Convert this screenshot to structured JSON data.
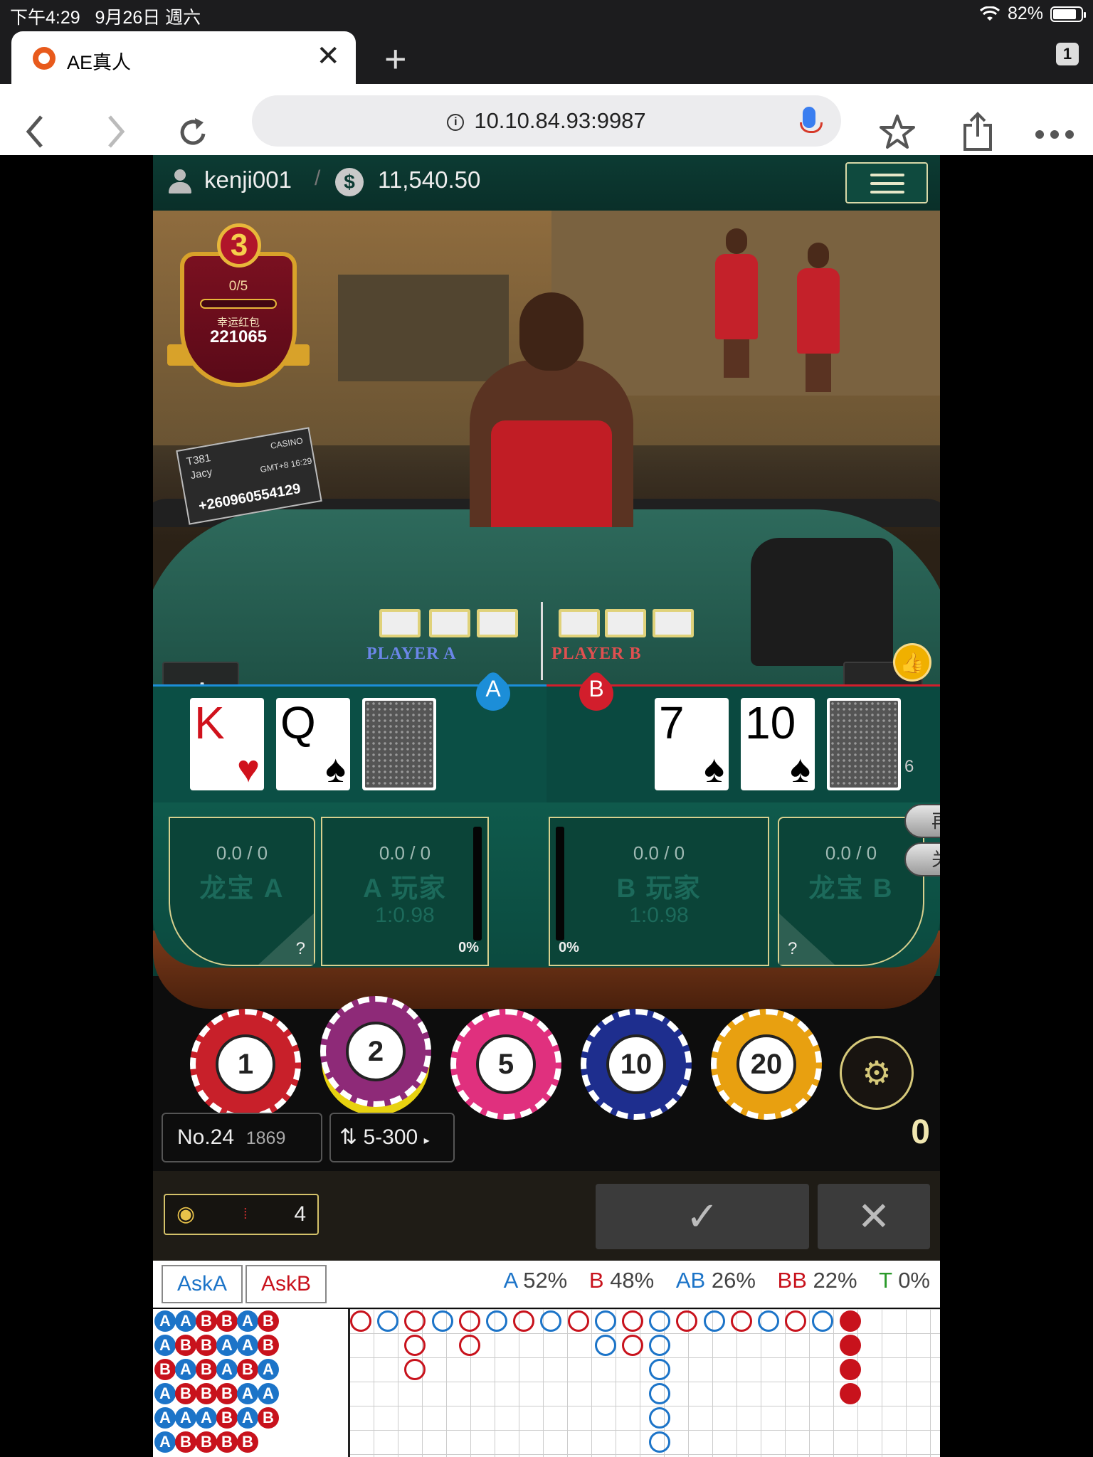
{
  "status_bar": {
    "time": "下午4:29",
    "date": "9月26日 週六",
    "battery": "82%"
  },
  "browser": {
    "tab_title": "AE真人",
    "tab_close": "✕",
    "new_tab": "+",
    "tab_count": "1",
    "url": "10.10.84.93:9987",
    "icons": [
      "back-icon",
      "forward-icon",
      "reload-icon",
      "info-icon",
      "mic-icon",
      "star-icon",
      "share-icon",
      "more-icon"
    ]
  },
  "game": {
    "username": "kenji001",
    "balance": "11,540.50",
    "promo": {
      "level": "3",
      "progress": "0/5",
      "label": "幸运红包",
      "amount": "221065"
    },
    "sign": {
      "table": "T381",
      "dealer": "Jacy",
      "tz": "GMT+8 16:29",
      "phone": "+260960554129",
      "brand": "CASINO"
    },
    "table_labels": {
      "a": "PLAYER A",
      "b": "PLAYER B"
    },
    "hand_a": {
      "tag": "A",
      "cards": [
        {
          "rank": "K",
          "suit": "♥"
        },
        {
          "rank": "Q",
          "suit": "♠"
        }
      ]
    },
    "hand_b": {
      "tag": "B",
      "cards": [
        {
          "rank": "7",
          "suit": "♠"
        },
        {
          "rank": "10",
          "suit": "♠"
        }
      ],
      "score": "6"
    },
    "side_pills": [
      "再",
      "关"
    ],
    "bets": [
      {
        "odds": "0.0 / 0",
        "name": "龙宝 A",
        "corner": "?"
      },
      {
        "odds": "0.0 / 0",
        "name": "A 玩家",
        "ratio": "1:0.98",
        "pct": "0%"
      },
      {
        "odds": "0.0 / 0",
        "name": "B 玩家",
        "ratio": "1:0.98",
        "pct": "0%"
      },
      {
        "odds": "0.0 / 0",
        "name": "龙宝 B",
        "corner": "?"
      }
    ],
    "chips": [
      {
        "value": "1",
        "color": "#c8202a"
      },
      {
        "value": "2",
        "color": "#8e2a78",
        "selected": true
      },
      {
        "value": "5",
        "color": "#e0307e"
      },
      {
        "value": "10",
        "color": "#1e2e8e"
      },
      {
        "value": "20",
        "color": "#e8a010"
      }
    ],
    "round": {
      "no": "No.24",
      "id": "1869",
      "limit": "5-300"
    },
    "bet_total": "0",
    "roads_count": "4",
    "confirm": "✓",
    "cancel": "✕",
    "ask": {
      "a": "AskA",
      "b": "AskB"
    },
    "stats": [
      {
        "key": "A",
        "val": "52%",
        "color": "#1c74c8"
      },
      {
        "key": "B",
        "val": "48%",
        "color": "#c8121c"
      },
      {
        "key": "AB",
        "val": "26%",
        "color": "#1c74c8"
      },
      {
        "key": "BB",
        "val": "22%",
        "color": "#c8121c"
      },
      {
        "key": "T",
        "val": "0%",
        "color": "#2a9a2a"
      }
    ],
    "bead_road": [
      [
        "A",
        "A",
        "B",
        "B",
        "A",
        "B"
      ],
      [
        "A",
        "B",
        "B",
        "A",
        "A",
        "B"
      ],
      [
        "B",
        "A",
        "B",
        "A",
        "B",
        "A"
      ],
      [
        "A",
        "B",
        "B",
        "B",
        "A",
        "A"
      ],
      [
        "A",
        "A",
        "A",
        "B",
        "A",
        "B"
      ],
      [
        "A",
        "B",
        "B",
        "B",
        "B",
        ""
      ]
    ]
  }
}
